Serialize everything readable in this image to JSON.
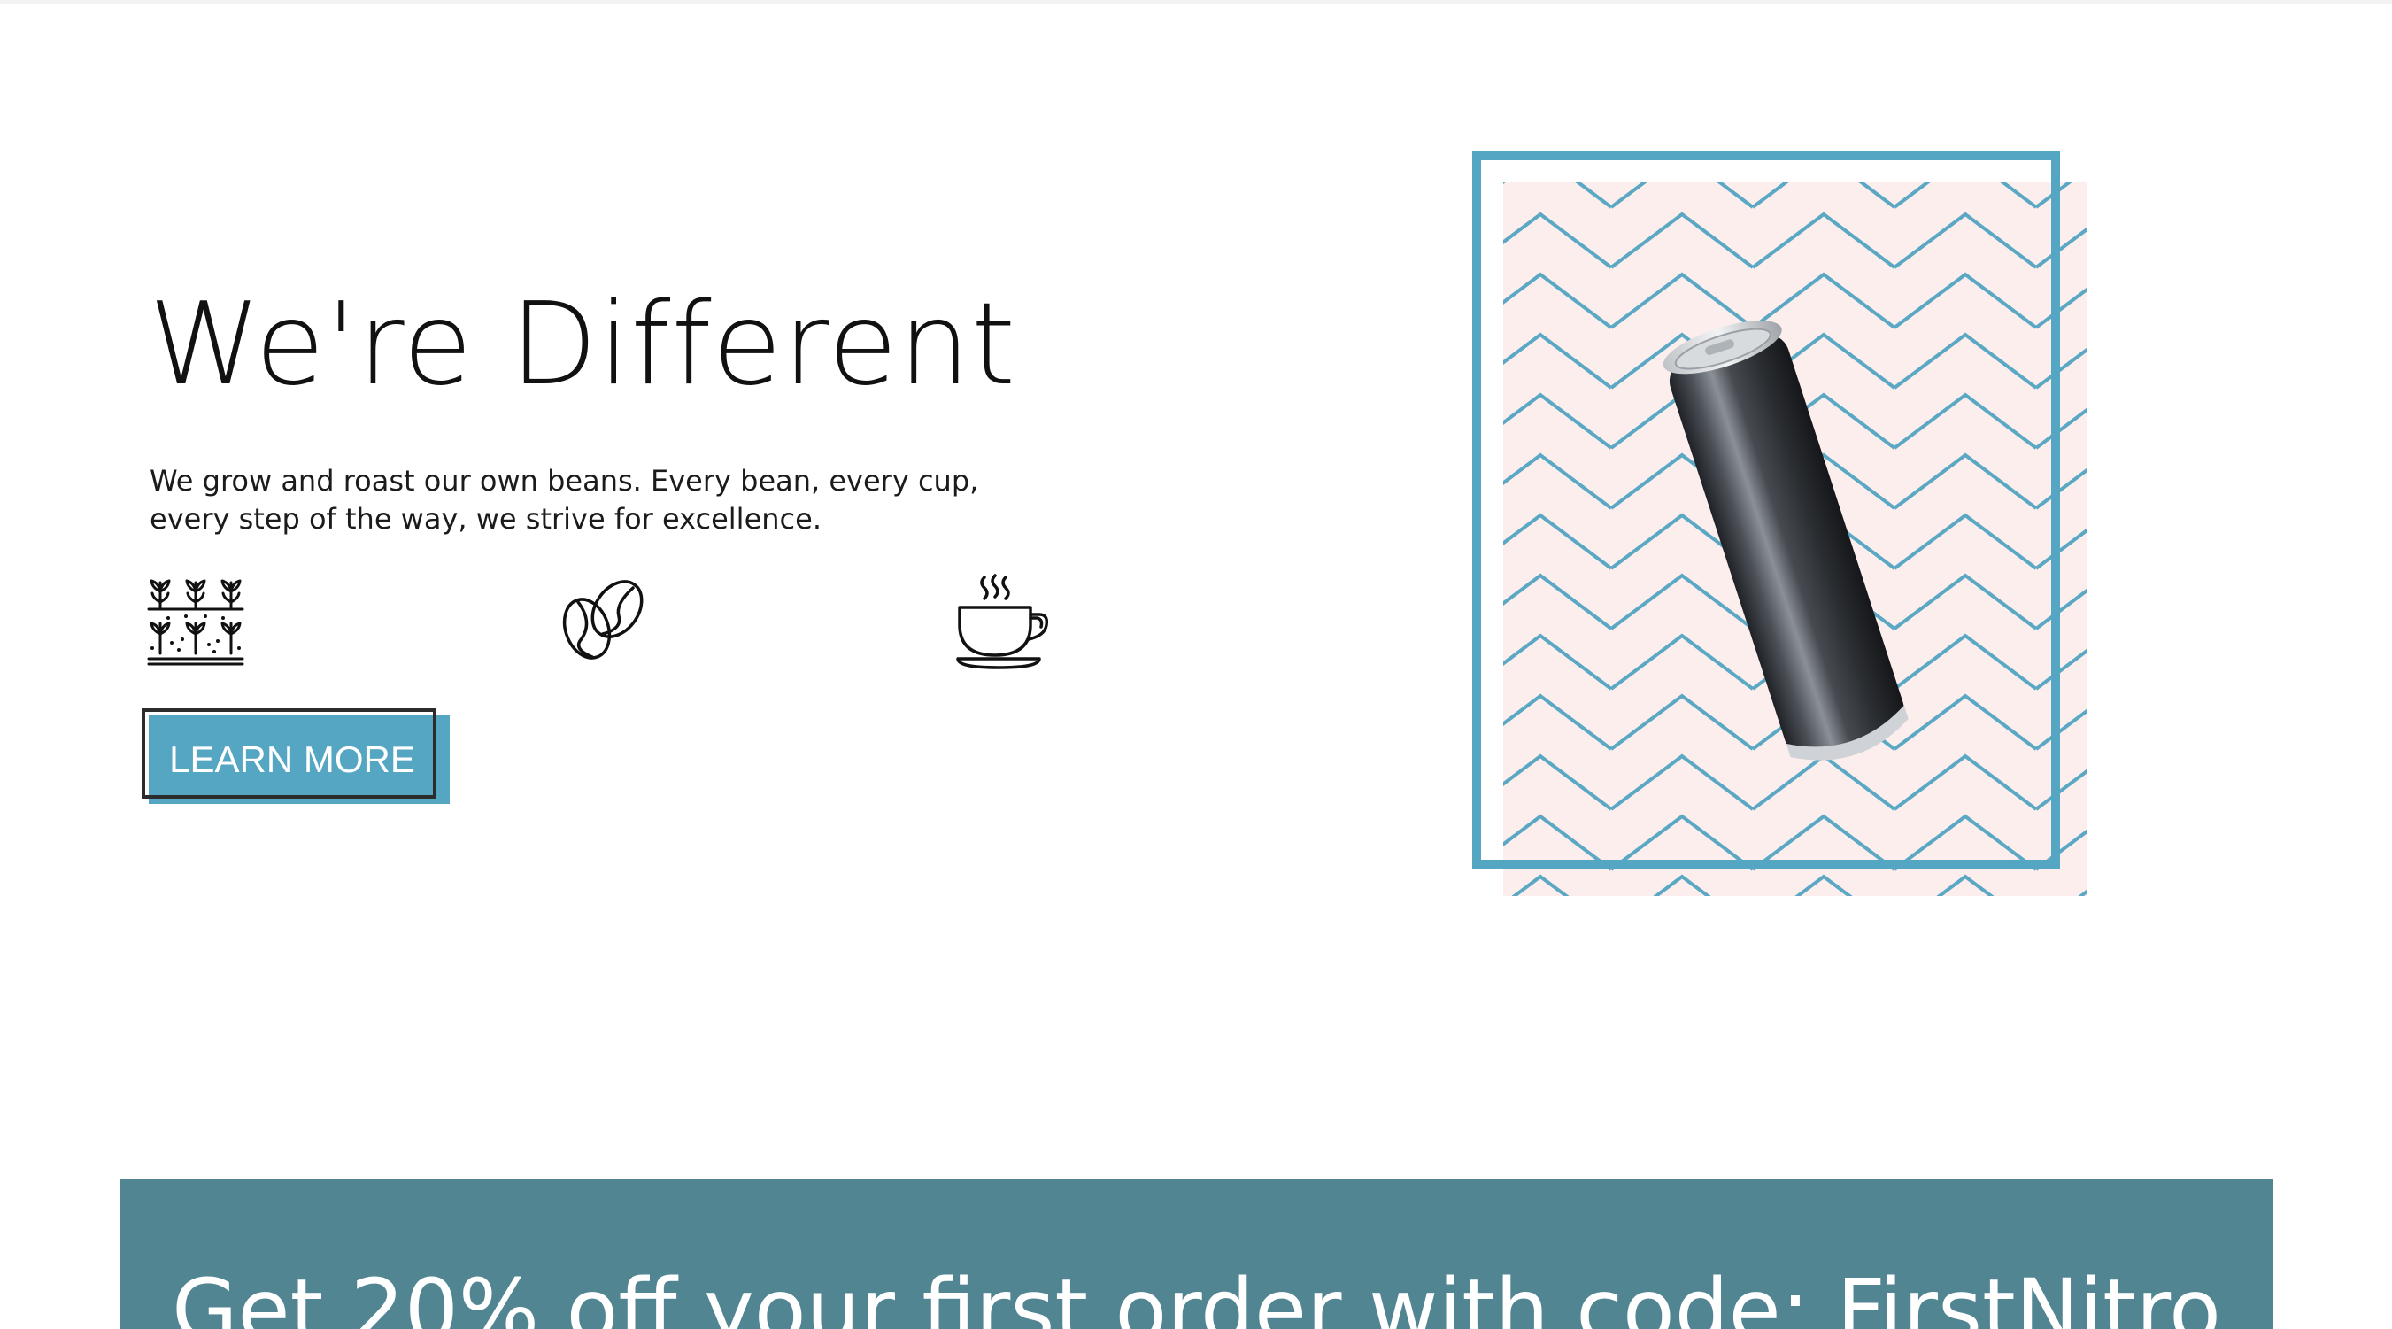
{
  "hero": {
    "title": "We're Different",
    "description": "We grow and roast our own beans. Every bean, every cup, every step of the way, we strive for excellence.",
    "cta_label": "LEARN MORE"
  },
  "features": {
    "icons": [
      "farm-field-icon",
      "coffee-bean-icon",
      "coffee-cup-icon"
    ]
  },
  "product": {
    "image": "nitro-coffee-can",
    "frame_color": "#55a6c2",
    "pattern_background": "#fdeeee"
  },
  "promo": {
    "text": "Get 20% off your first order with code: FirstNitro",
    "background": "#518592"
  },
  "colors": {
    "accent": "#55a6c2",
    "banner": "#518592",
    "text": "#111111"
  }
}
